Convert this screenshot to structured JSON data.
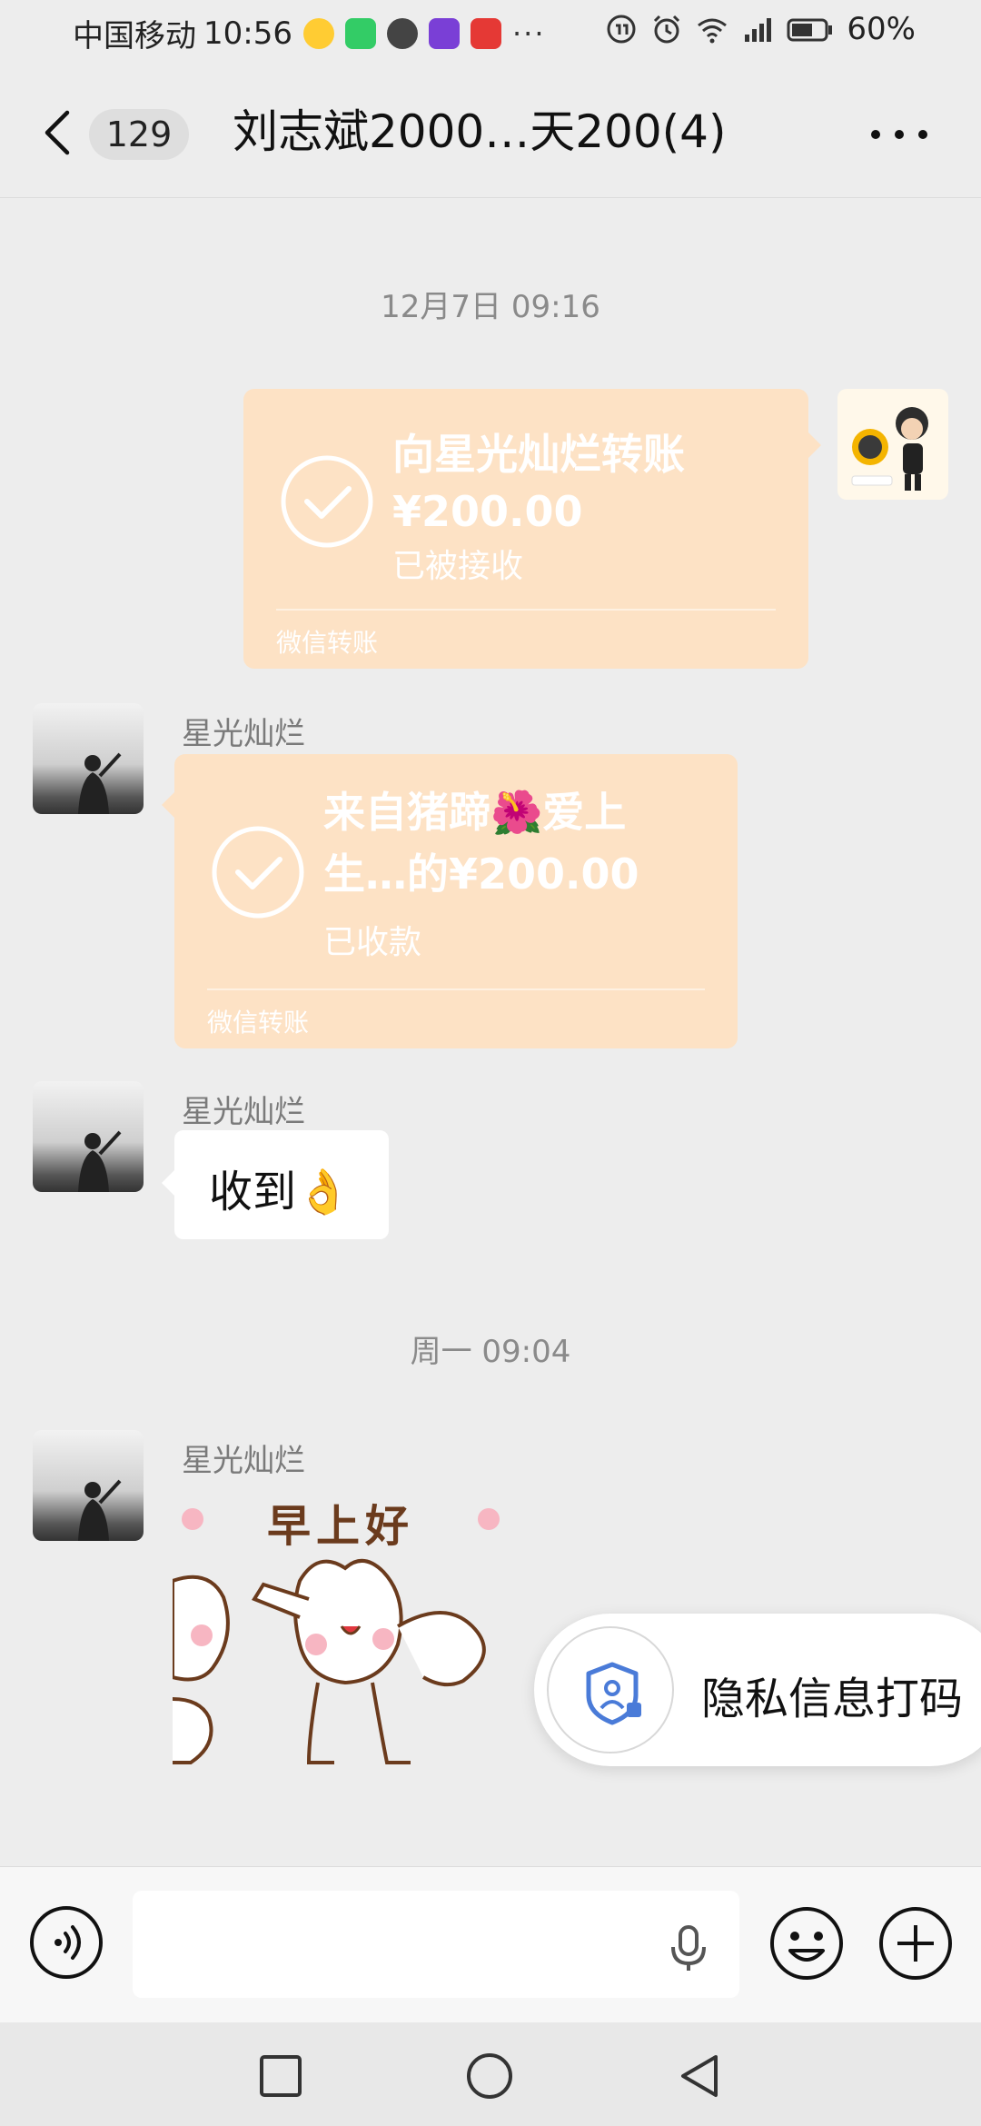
{
  "status_bar": {
    "carrier": "中国移动",
    "time": "10:56",
    "more": "···",
    "battery_percent": "60%",
    "icons": [
      "weibo-icon",
      "video-app-icon",
      "ball-app-icon",
      "bank-app-icon",
      "news-app-icon",
      "hd-call-icon",
      "alarm-icon",
      "wifi-icon",
      "4g-signal-icon",
      "battery-icon"
    ]
  },
  "header": {
    "unread_count": "129",
    "title": "刘志斌2000…天200(4)"
  },
  "messages": {
    "timestamp_1": "12月7日 09:16",
    "transfer_out": {
      "title": "向星光灿烂转账",
      "amount": "¥200.00",
      "status": "已被接收",
      "footer": "微信转账"
    },
    "sender_1": "星光灿烂",
    "transfer_in": {
      "title": "来自猪蹄🌺爱上生…的¥200.00",
      "status": "已收款",
      "footer": "微信转账"
    },
    "sender_2": "星光灿烂",
    "text_1": "收到👌",
    "timestamp_2": "周一 09:04",
    "sender_3": "星光灿烂",
    "sticker_text": "早上好"
  },
  "privacy_popup": {
    "label": "隐私信息打码"
  },
  "colors": {
    "background": "#ededed",
    "transfer_card": "#fde2c5",
    "privacy_icon": "#4a7bd8"
  }
}
